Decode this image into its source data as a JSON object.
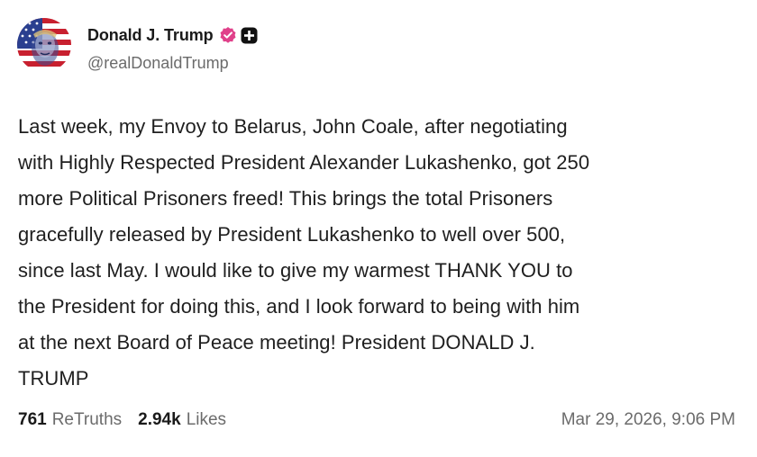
{
  "author": {
    "display_name": "Donald J. Trump",
    "handle": "@realDonaldTrump",
    "avatar_icon": "flag-portrait-avatar",
    "verified_icon": "verified-badge-icon",
    "verified_color": "#e0418a",
    "badge_icon": "plus-badge-icon"
  },
  "post": {
    "text": "Last week, my Envoy to Belarus, John Coale, after negotiating\nwith Highly Respected President Alexander Lukashenko, got 250\nmore Political Prisoners freed! This brings the total Prisoners\ngracefully released by President Lukashenko to well over 500,\nsince last May. I would like to give my warmest THANK YOU to\nthe President for doing this, and I look forward to being with him\nat the next Board of Peace meeting! President DONALD J.\nTRUMP"
  },
  "stats": {
    "retruths_count": "761",
    "retruths_label": "ReTruths",
    "likes_count": "2.94k",
    "likes_label": "Likes"
  },
  "timestamp": "Mar 29, 2026, 9:06 PM"
}
